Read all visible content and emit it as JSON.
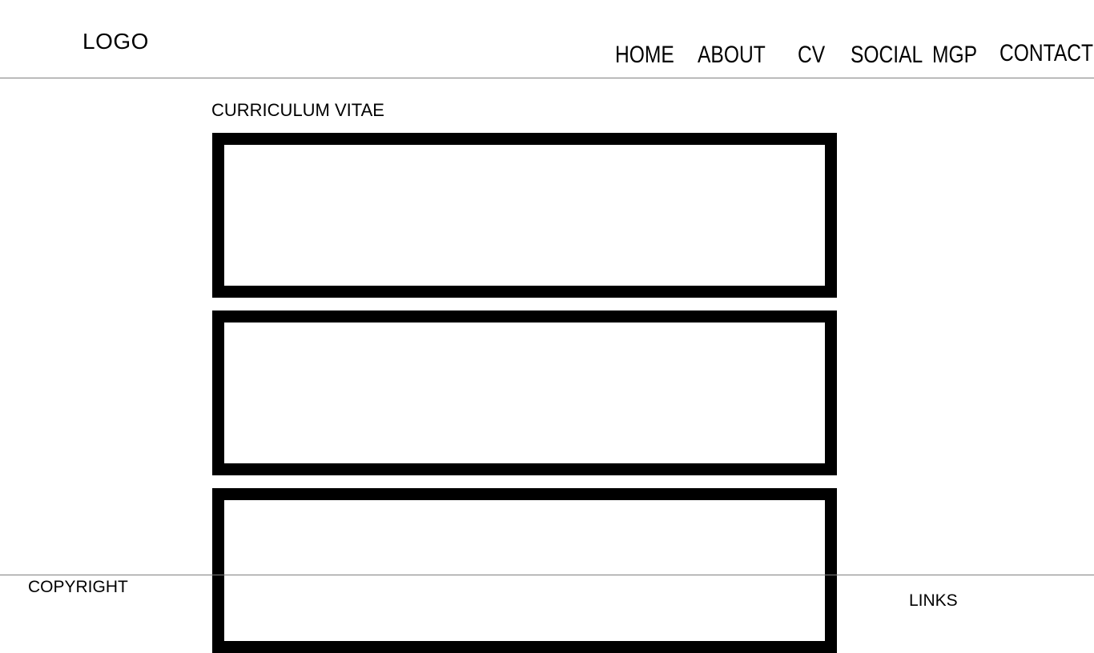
{
  "header": {
    "logo": "LOGO",
    "nav": [
      {
        "label": "HOME"
      },
      {
        "label": "ABOUT"
      },
      {
        "label": "CV"
      },
      {
        "label": "SOCIAL"
      },
      {
        "label": "MGP"
      },
      {
        "label": "CONTACT"
      }
    ]
  },
  "main": {
    "title": "CURRICULUM VITAE"
  },
  "footer": {
    "copyright": "COPYRIGHT",
    "links": "LINKS"
  }
}
